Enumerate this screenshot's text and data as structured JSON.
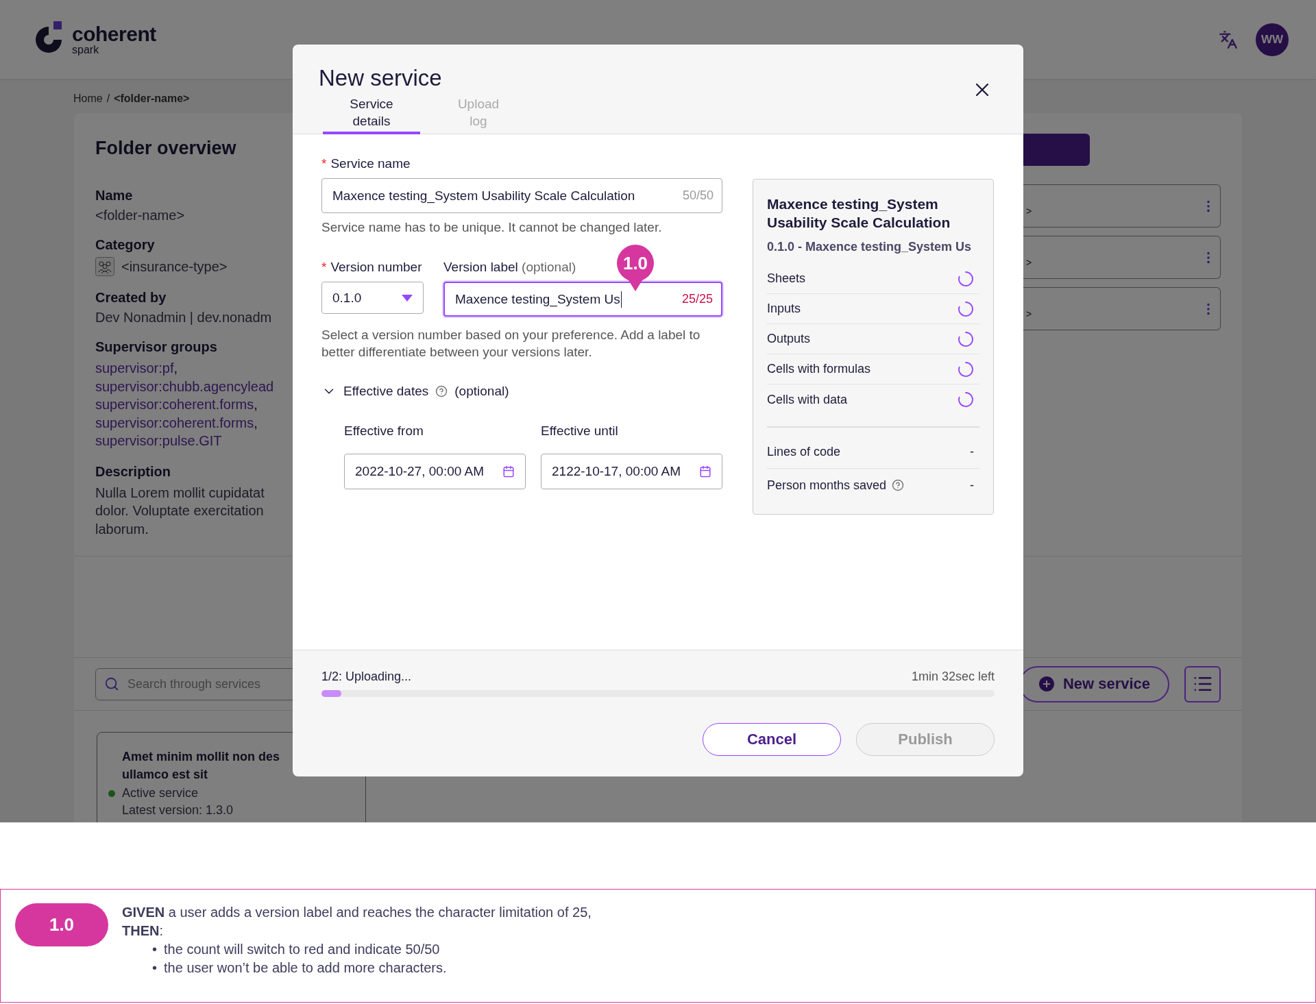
{
  "header": {
    "logo": {
      "name": "coherent",
      "sub": "spark"
    },
    "avatar": "WW"
  },
  "breadcrumb": {
    "items": [
      "Home",
      "<folder-name>"
    ],
    "separator": "/"
  },
  "folder": {
    "title": "Folder overview",
    "fields": [
      {
        "label": "Name",
        "value": "<folder-name>"
      },
      {
        "label": "Category",
        "value": "<insurance-type>",
        "kind": "category"
      },
      {
        "label": "Created by",
        "value": "Dev Nonadmin | dev.nonadm"
      }
    ],
    "supervisor_groups": {
      "label": "Supervisor groups",
      "items": [
        {
          "text": "supervisor:pf",
          "sep": ","
        },
        {
          "text": "supervisor:chubb.agencylead"
        },
        {
          "text": "supervisor:coherent.forms",
          "sep": ","
        },
        {
          "text": "supervisor:coherent.forms",
          "sep": ","
        },
        {
          "text": "supervisor:pulse.GIT"
        }
      ]
    },
    "description": {
      "label": "Description",
      "lines": [
        "Nulla Lorem mollit cupidatat",
        "dolor. Voluptate exercitation",
        "laborum."
      ]
    },
    "version_rows": [
      {
        "text": ">"
      },
      {
        "text": ">"
      },
      {
        "text": ">"
      }
    ],
    "search": {
      "placeholder": "Search through services"
    },
    "new_service_button": "New service",
    "service_card": {
      "title_lines": [
        "Amet minim mollit non des",
        "ullamco est sit"
      ],
      "status": "Active service",
      "version": "Latest version: 1.3.0"
    }
  },
  "modal": {
    "title": "New service",
    "tabs": [
      {
        "label": "Service details",
        "selected": true
      },
      {
        "label": "Upload log",
        "selected": false
      }
    ],
    "service_name": {
      "label": "Service name",
      "required_mark": "*",
      "value": "Maxence testing_System Usability Scale Calculation",
      "count": "50/50",
      "error": false,
      "focused": false,
      "help": "Service name has to be unique. It cannot be changed later."
    },
    "version_number": {
      "label": "Version number",
      "required_mark": "*",
      "value": "0.1.0"
    },
    "version_label": {
      "label": "Version label",
      "optional": "(optional)",
      "value": "Maxence testing_System Us",
      "count": "25/25",
      "error": true,
      "focused": true
    },
    "version_help": "Select a version number based on your preference. Add a label to better differentiate between your versions later.",
    "effective_dates": {
      "label": "Effective dates",
      "optional": "(optional)",
      "expanded": true,
      "from": {
        "label": "Effective from",
        "value": "2022-10-27, 00:00 AM"
      },
      "until": {
        "label": "Effective until",
        "value": "2122-10-17, 00:00 AM"
      }
    },
    "marker": "1.0",
    "summary": {
      "title": "Maxence testing_System Usability Scale Calculation",
      "subtitle": "0.1.0 - Maxence testing_System Us",
      "stats": [
        {
          "label": "Sheets",
          "loading": true
        },
        {
          "label": "Inputs",
          "loading": true
        },
        {
          "label": "Outputs",
          "loading": true
        },
        {
          "label": "Cells with formulas",
          "loading": true
        },
        {
          "label": "Cells with data",
          "loading": true
        }
      ],
      "metrics": [
        {
          "label": "Lines of code",
          "value": "-",
          "help": false
        },
        {
          "label": "Person months saved",
          "value": "-",
          "help": true
        }
      ]
    },
    "upload": {
      "status": "1/2: Uploading...",
      "time_left": "1min 32sec left",
      "level": 0.03
    },
    "buttons": [
      {
        "label": "Cancel",
        "disabled": false
      },
      {
        "label": "Publish",
        "disabled": true
      }
    ]
  },
  "annotation": {
    "badge": "1.0",
    "lines": [
      "**GIVEN** a user adds a version label and reaches the character limitation of 25,",
      "**THEN**:"
    ],
    "bullets": [
      {
        "bullet": "•",
        "text": "the count will switch to red and indicate 50/50"
      },
      {
        "bullet": "•",
        "text": "the user won’t be able to add more characters."
      }
    ]
  }
}
